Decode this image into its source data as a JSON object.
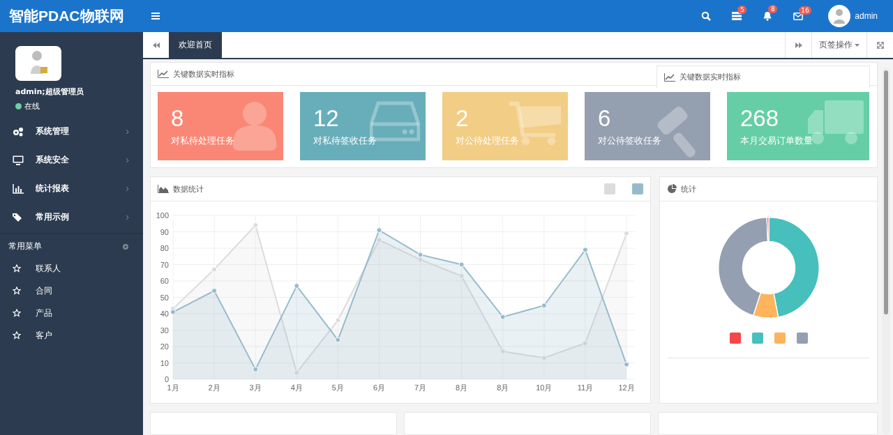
{
  "header": {
    "logo": "智能PDAC物联网",
    "badges": [
      {
        "count": "5"
      },
      {
        "count": "8"
      },
      {
        "count": "16"
      }
    ],
    "user": "admin"
  },
  "sidebar": {
    "user_name": "admin;超级管理员",
    "status": "在线",
    "items": [
      {
        "label": "系统管理"
      },
      {
        "label": "系统安全"
      },
      {
        "label": "统计报表"
      },
      {
        "label": "常用示例"
      }
    ],
    "favorites_title": "常用菜单",
    "favorites": [
      {
        "label": "联系人"
      },
      {
        "label": "合同"
      },
      {
        "label": "产品"
      },
      {
        "label": "客户"
      }
    ]
  },
  "tabs": [
    {
      "label": "欢迎首页",
      "selected": true
    }
  ],
  "tab_actions": {
    "label": "页签操作"
  },
  "metrics": {
    "title": "关键数据实时指标",
    "overlay_title": "关键数据实时指标",
    "cards": [
      {
        "value": "8",
        "label": "对私待处理任务",
        "color": "#fa8775"
      },
      {
        "value": "12",
        "label": "对私待签收任务",
        "color": "#68aeba"
      },
      {
        "value": "2",
        "label": "对公待处理任务",
        "color": "#f2cd85"
      },
      {
        "value": "6",
        "label": "对公待签收任务",
        "color": "#949fb0"
      },
      {
        "value": "268",
        "label": "本月交易订单数量",
        "color": "#65ceA7"
      }
    ]
  },
  "line_panel": {
    "title": "数据统计",
    "chart_data": {
      "type": "area",
      "categories": [
        "1月",
        "2月",
        "3月",
        "4月",
        "5月",
        "6月",
        "7月",
        "8月",
        "8月",
        "10月",
        "11月",
        "12月"
      ],
      "ylim": [
        0,
        100
      ],
      "grid": true,
      "yticks": [
        0,
        10,
        20,
        30,
        40,
        50,
        60,
        70,
        80,
        90,
        100
      ],
      "series": [
        {
          "color": "#dcdcdc",
          "values": [
            43,
            67,
            94,
            4,
            36,
            85,
            73,
            63,
            17,
            13,
            22,
            89
          ]
        },
        {
          "color": "#97bbcd",
          "values": [
            41,
            54,
            6,
            57,
            24,
            91,
            76,
            70,
            38,
            45,
            79,
            9
          ]
        }
      ]
    }
  },
  "pie_panel": {
    "title": "统计",
    "legend": [
      {
        "color": "#f7464a"
      },
      {
        "color": "#46bfbd"
      },
      {
        "color": "#fdb45c"
      },
      {
        "color": "#949fb1"
      }
    ]
  }
}
